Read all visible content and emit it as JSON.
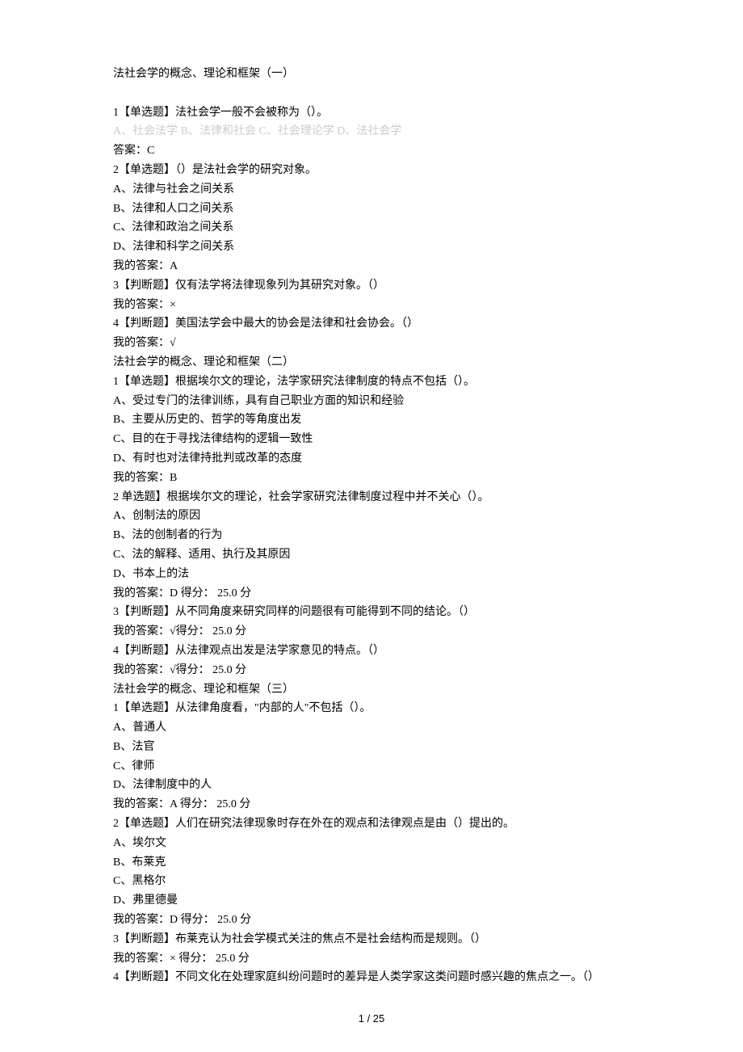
{
  "title": "法社会学的概念、理论和框架（一）",
  "q1": {
    "stem": "1【单选题】法社会学一般不会被称为（）。",
    "opts": "A、社会法学 B、法律和社会 C、社会理论学 D、法社会学",
    "ans": "答案：C"
  },
  "q2": {
    "stem": "2【单选题】（）是法社会学的研究对象。",
    "a": "A、法律与社会之间关系",
    "b": "B、法律和人口之间关系",
    "c": "C、法律和政治之间关系",
    "d": "D、法律和科学之间关系",
    "ans": "我的答案：A"
  },
  "q3": {
    "stem": "3【判断题】仅有法学将法律现象列为其研究对象。（）",
    "ans": "我的答案：×"
  },
  "q4": {
    "stem": "4【判断题】美国法学会中最大的协会是法律和社会协会。（）",
    "ans": "我的答案：√"
  },
  "title2": "法社会学的概念、理论和框架（二）",
  "q5": {
    "stem": "1【单选题】根据埃尔文的理论，法学家研究法律制度的特点不包括（）。",
    "a": "A、受过专门的法律训练，具有自己职业方面的知识和经验",
    "b": "B、主要从历史的、哲学的等角度出发",
    "c": "C、目的在于寻找法律结构的逻辑一致性",
    "d": "D、有时也对法律持批判或改革的态度",
    "ans": "我的答案：B"
  },
  "q6": {
    "stem": "2 单选题】根据埃尔文的理论，社会学家研究法律制度过程中并不关心（）。",
    "a": "A、创制法的原因",
    "b": "B、法的创制者的行为",
    "c": "C、法的解释、适用、执行及其原因",
    "d": "D、书本上的法",
    "ans": "我的答案：D 得分： 25.0 分"
  },
  "q7": {
    "stem": "3【判断题】从不同角度来研究同样的问题很有可能得到不同的结论。（）",
    "ans": "我的答案：√得分： 25.0 分"
  },
  "q8": {
    "stem": "4【判断题】从法律观点出发是法学家意见的特点。（）",
    "ans": "我的答案：√得分： 25.0 分"
  },
  "title3": "法社会学的概念、理论和框架（三）",
  "q9": {
    "stem": "1【单选题】从法律角度看，\"内部的人\"不包括（）。",
    "a": "A、普通人",
    "b": "B、法官",
    "c": "C、律师",
    "d": "D、法律制度中的人",
    "ans": "我的答案：A 得分： 25.0 分"
  },
  "q10": {
    "stem": "2【单选题】人们在研究法律现象时存在外在的观点和法律观点是由（）提出的。",
    "a": "A、埃尔文",
    "b": "B、布莱克",
    "c": "C、黑格尔",
    "d": "D、弗里德曼",
    "ans": "我的答案：D 得分： 25.0 分"
  },
  "q11": {
    "stem": "3【判断题】布莱克认为社会学模式关注的焦点不是社会结构而是规则。（）",
    "ans": "我的答案：× 得分： 25.0 分"
  },
  "q12": {
    "stem": "4【判断题】不同文化在处理家庭纠纷问题时的差异是人类学家这类问题时感兴趣的焦点之一。（）"
  },
  "footer": "1 / 25"
}
